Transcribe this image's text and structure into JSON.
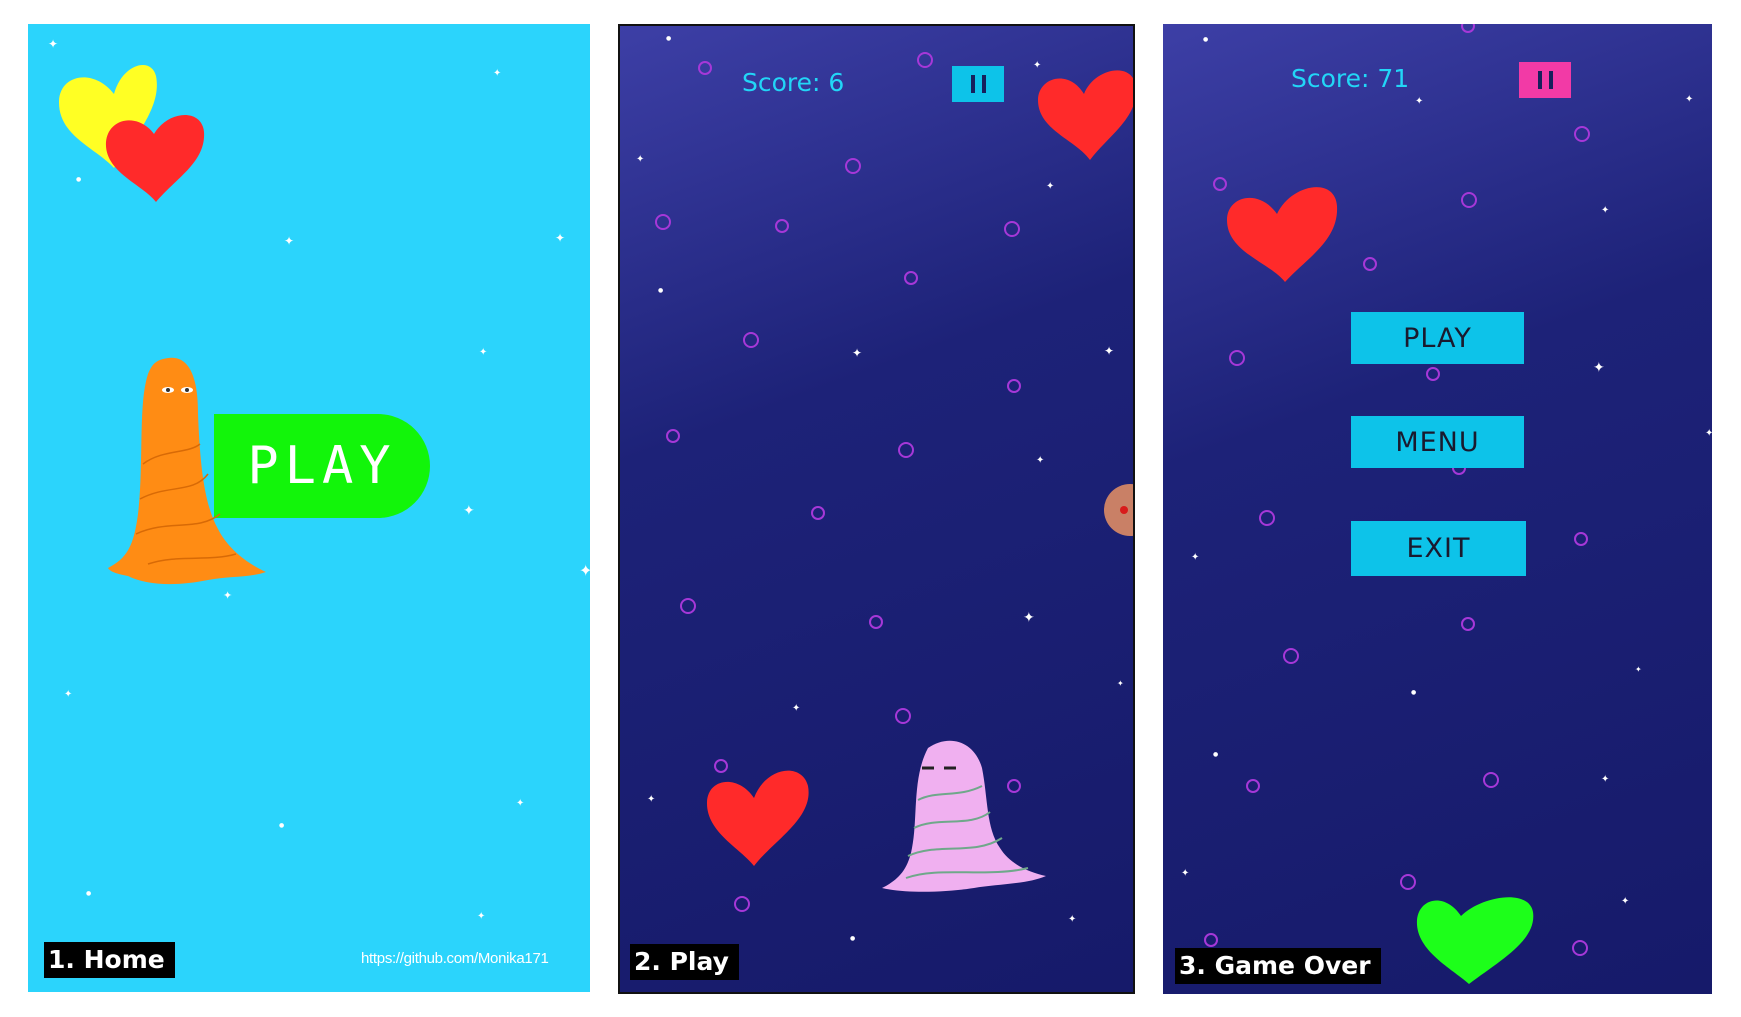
{
  "colors": {
    "home_bg": "#2bd4fc",
    "play_bg": "#1d2278",
    "play_button": "#12f50a",
    "menu_button": "#0dc3e9",
    "score_text": "#22d6f7",
    "pause_cyan": "#0dc3e9",
    "pause_pink": "#f23aa6",
    "heart_red": "#ff2a2a",
    "heart_yellow": "#ffff24",
    "heart_green": "#1dff1a",
    "player_home": "#ff8c14",
    "player_play": "#f0b0f0"
  },
  "panels": {
    "home": {
      "caption": "1. Home",
      "play_label": "PLAY",
      "link": "https://github.com/Monika171"
    },
    "play": {
      "caption": "2. Play",
      "score": "Score: 6",
      "pause_icon": "pause-icon"
    },
    "gameover": {
      "caption": "3. Game Over",
      "score": "Score: 71",
      "pause_icon": "pause-icon",
      "buttons": [
        "PLAY",
        "MENU",
        "EXIT"
      ]
    }
  }
}
